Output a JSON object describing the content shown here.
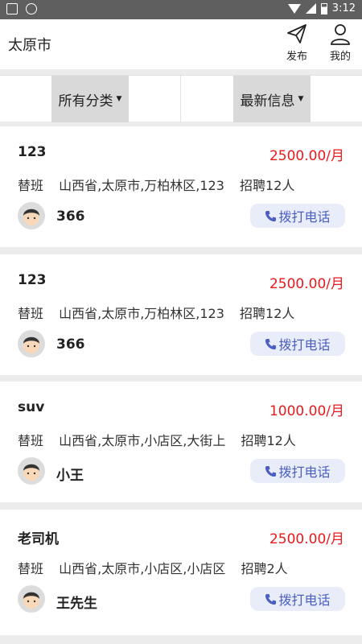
{
  "status_bar": {
    "time": "3:12"
  },
  "header": {
    "city": "太原市",
    "publish_label": "发布",
    "mine_label": "我的"
  },
  "filters": {
    "category": "所有分类",
    "latest": "最新信息"
  },
  "listings": [
    {
      "title": "123",
      "salary": "2500.00/月",
      "type": "替班",
      "location": "山西省,太原市,万柏林区,123",
      "hiring": "招聘12人",
      "name": "366",
      "call": "拨打电话"
    },
    {
      "title": "123",
      "salary": "2500.00/月",
      "type": "替班",
      "location": "山西省,太原市,万柏林区,123",
      "hiring": "招聘12人",
      "name": "366",
      "call": "拨打电话"
    },
    {
      "title": "suv",
      "salary": "1000.00/月",
      "type": "替班",
      "location": "山西省,太原市,小店区,大街上",
      "hiring": "招聘12人",
      "name": "小王",
      "call": "拨打电话"
    },
    {
      "title": "老司机",
      "salary": "2500.00/月",
      "type": "替班",
      "location": "山西省,太原市,小店区,小店区",
      "hiring": "招聘2人",
      "name": "王先生",
      "call": "拨打电话"
    }
  ],
  "colors": {
    "salary": "#e8191d",
    "call_text": "#4a5fc1",
    "call_bg": "#e9ecf9"
  }
}
